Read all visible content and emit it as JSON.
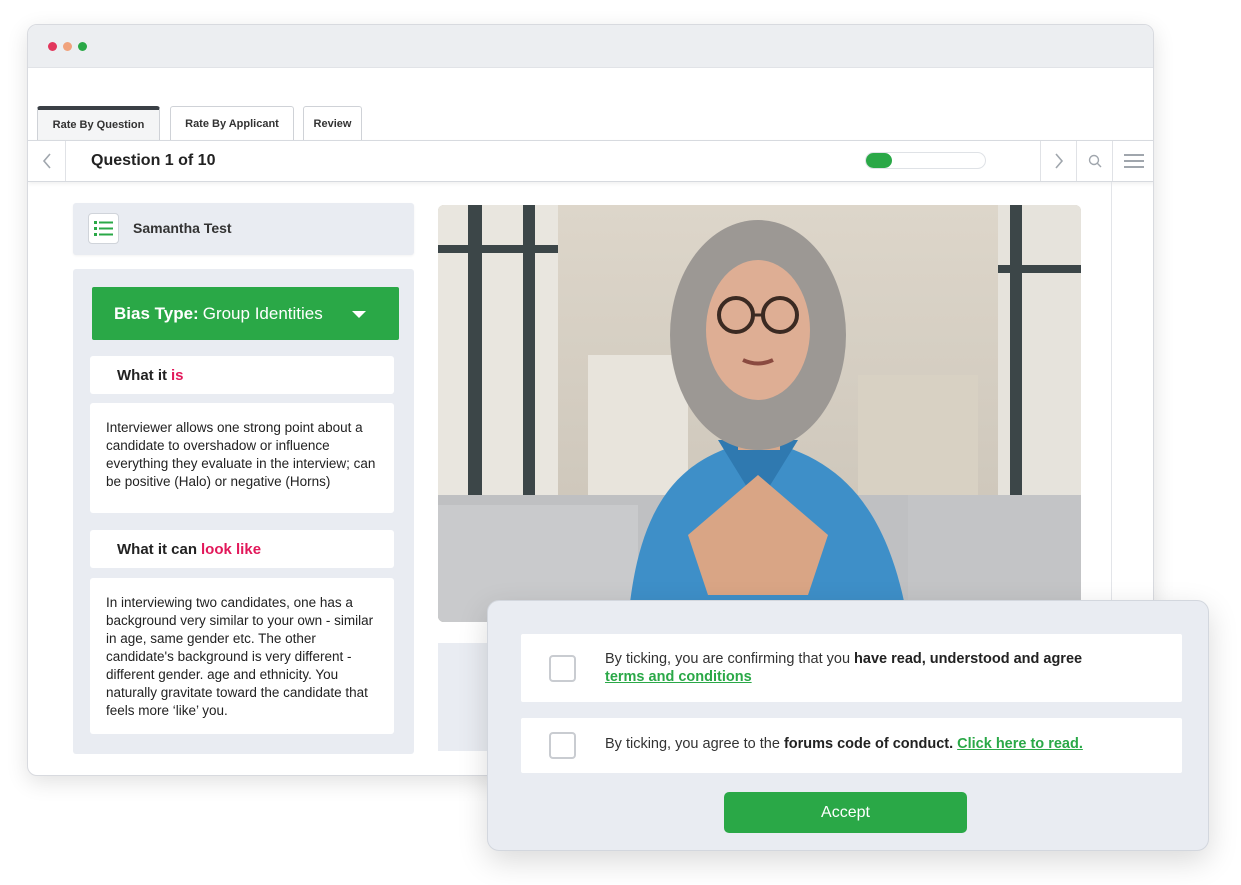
{
  "window": {
    "traffic_lights": [
      "close",
      "minimize",
      "maximize"
    ]
  },
  "tabs": [
    {
      "label": "Rate By Question",
      "active": true
    },
    {
      "label": "Rate By Applicant",
      "active": false
    },
    {
      "label": "Review",
      "active": false
    }
  ],
  "question_bar": {
    "title": "Question 1 of 10",
    "progress": 0.1,
    "prev_icon": "chevron-left-icon",
    "next_icon": "chevron-right-icon",
    "search_icon": "search-icon",
    "menu_icon": "hamburger-menu-icon"
  },
  "candidate": {
    "name": "Samantha Test",
    "icon": "list-icon"
  },
  "bias": {
    "label": "Bias Type:",
    "value": "Group Identities",
    "what_it_prefix": "What it",
    "what_it_accent": "is",
    "what_it_text": "Interviewer allows one strong point about a candidate to overshadow or influence everything they evaluate in the interview; can be positive (Halo) or negative (Horns)",
    "looks_like_prefix": "What it can",
    "looks_like_accent": "look like",
    "looks_like_text": "In interviewing two candidates, one has a background very similar to your own - similar in age, same gender etc. The other candidate's background is very different - different gender. age and ethnicity. You naturally gravitate toward the candidate that feels more ‘like’ you."
  },
  "consent": {
    "row1_prefix": "By ticking, you are confirming that you ",
    "row1_bold": "have read, understood and agree",
    "row1_link": "terms and conditions",
    "row2_prefix": "By ticking, you agree to the ",
    "row2_bold": "forums code of conduct.",
    "row2_link": "Click here to read.",
    "accept_label": "Accept"
  },
  "colors": {
    "accent_green": "#2aa847",
    "accent_pink": "#e2185a",
    "panel_bg": "#e9ecf2"
  }
}
